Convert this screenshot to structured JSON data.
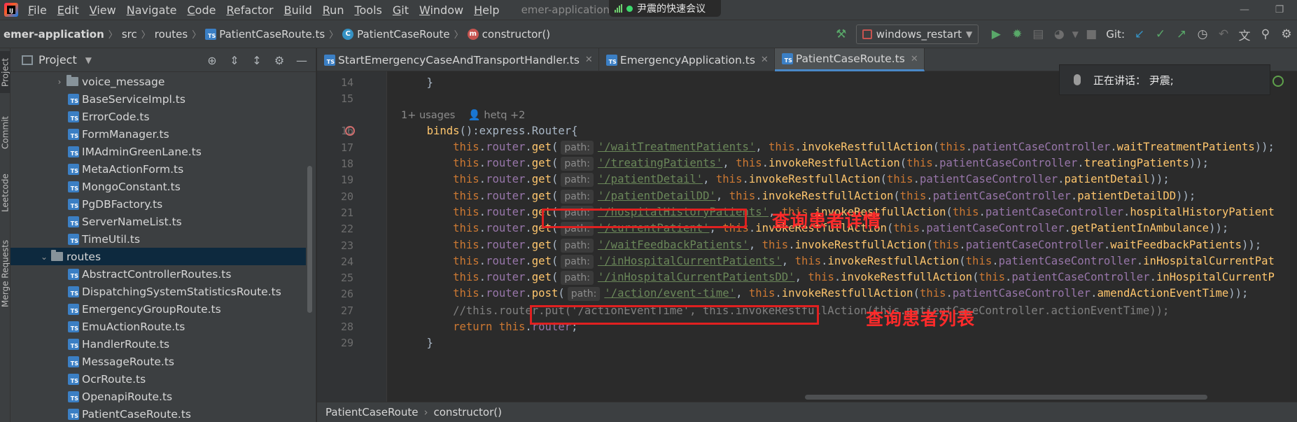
{
  "menu": {
    "items": [
      "File",
      "Edit",
      "View",
      "Navigate",
      "Code",
      "Refactor",
      "Build",
      "Run",
      "Tools",
      "Git",
      "Window",
      "Help"
    ],
    "window_title": "emer-application - P",
    "meeting_label": "尹震的快速会议"
  },
  "breadcrumb": {
    "project": "emer-application",
    "folder1": "src",
    "folder2": "routes",
    "file": "PatientCaseRoute.ts",
    "class": "PatientCaseRoute",
    "method": "constructor()"
  },
  "toolbar": {
    "run_config": "windows_restart",
    "git_label": "Git:"
  },
  "sidebar_tabs": [
    "Project",
    "Commit",
    "Leetcode",
    "Merge Requests"
  ],
  "project_panel": {
    "title": "Project",
    "tree": [
      {
        "label": "voice_message",
        "type": "folder",
        "indent": 1,
        "arrow": "›"
      },
      {
        "label": "BaseServiceImpl.ts",
        "type": "ts",
        "indent": 2
      },
      {
        "label": "ErrorCode.ts",
        "type": "ts",
        "indent": 2
      },
      {
        "label": "FormManager.ts",
        "type": "ts",
        "indent": 2
      },
      {
        "label": "IMAdminGreenLane.ts",
        "type": "ts",
        "indent": 2
      },
      {
        "label": "MetaActionForm.ts",
        "type": "ts",
        "indent": 2
      },
      {
        "label": "MongoConstant.ts",
        "type": "ts",
        "indent": 2
      },
      {
        "label": "PgDBFactory.ts",
        "type": "ts",
        "indent": 2
      },
      {
        "label": "ServerNameList.ts",
        "type": "ts",
        "indent": 2
      },
      {
        "label": "TimeUtil.ts",
        "type": "ts",
        "indent": 2
      },
      {
        "label": "routes",
        "type": "folder",
        "indent": 0,
        "arrow": "⌄",
        "selected": true
      },
      {
        "label": "AbstractControllerRoutes.ts",
        "type": "ts",
        "indent": 2
      },
      {
        "label": "DispatchingSystemStatisticsRoute.ts",
        "type": "ts",
        "indent": 2
      },
      {
        "label": "EmergencyGroupRoute.ts",
        "type": "ts",
        "indent": 2
      },
      {
        "label": "EmuActionRoute.ts",
        "type": "ts",
        "indent": 2
      },
      {
        "label": "HandlerRoute.ts",
        "type": "ts",
        "indent": 2
      },
      {
        "label": "MessageRoute.ts",
        "type": "ts",
        "indent": 2
      },
      {
        "label": "OcrRoute.ts",
        "type": "ts",
        "indent": 2
      },
      {
        "label": "OpenapiRoute.ts",
        "type": "ts",
        "indent": 2
      },
      {
        "label": "PatientCaseRoute.ts",
        "type": "ts",
        "indent": 2
      }
    ]
  },
  "tabs": [
    {
      "label": "StartEmergencyCaseAndTransportHandler.ts",
      "active": false
    },
    {
      "label": "EmergencyApplication.ts",
      "active": false
    },
    {
      "label": "PatientCaseRoute.ts",
      "active": true
    }
  ],
  "editor": {
    "usages": "1+ usages",
    "author": "hetq +2",
    "lines": [
      {
        "n": "14",
        "kind": "brace",
        "text": "    }"
      },
      {
        "n": "15",
        "kind": "blank",
        "text": ""
      },
      {
        "n": "",
        "kind": "usages",
        "text": ""
      },
      {
        "n": "16",
        "kind": "binds",
        "text": ""
      },
      {
        "n": "17",
        "kind": "route",
        "method": "get",
        "path": "/waitTreatmentPatients",
        "action": "waitTreatmentPatients",
        "tail": "));"
      },
      {
        "n": "18",
        "kind": "route",
        "method": "get",
        "path": "/treatingPatients",
        "action": "treatingPatients",
        "tail": "));"
      },
      {
        "n": "19",
        "kind": "route",
        "method": "get",
        "path": "/patientDetail",
        "action": "patientDetail",
        "tail": "));"
      },
      {
        "n": "20",
        "kind": "route",
        "method": "get",
        "path": "/patientDetailDD",
        "action": "patientDetailDD",
        "tail": "));"
      },
      {
        "n": "21",
        "kind": "route",
        "method": "get",
        "path": "/hospitalHistoryPatients",
        "action": "hospitalHistoryPatient",
        "tail": ""
      },
      {
        "n": "22",
        "kind": "route",
        "method": "get",
        "path": "/currentPatient",
        "action": "getPatientInAmbulance",
        "tail": "));"
      },
      {
        "n": "23",
        "kind": "route",
        "method": "get",
        "path": "/waitFeedbackPatients",
        "action": "waitFeedbackPatients",
        "tail": "));"
      },
      {
        "n": "24",
        "kind": "route",
        "method": "get",
        "path": "/inHospitalCurrentPatients",
        "action": "inHospitalCurrentPat",
        "tail": ""
      },
      {
        "n": "25",
        "kind": "route",
        "method": "get",
        "path": "/inHospitalCurrentPatientsDD",
        "action": "inHospitalCurrentP",
        "tail": ""
      },
      {
        "n": "26",
        "kind": "route",
        "method": "post",
        "path": "/action/event-time",
        "action": "amendActionEventTime",
        "tail": "));"
      },
      {
        "n": "27",
        "kind": "comment",
        "text": "//this.router.put('/actionEventTime', this.invokeRestfullAction(this.patientCaseController.actionEventTime));"
      },
      {
        "n": "28",
        "kind": "return",
        "text": ""
      },
      {
        "n": "29",
        "kind": "brace",
        "text": "    }"
      }
    ],
    "hint_label": "path:",
    "annotations": {
      "detail": "查询患者详情",
      "list": "查询患者列表"
    }
  },
  "speaking": {
    "text": "正在讲话：  尹震;"
  },
  "bottom_breadcrumb": {
    "class": "PatientCaseRoute",
    "method": "constructor()"
  },
  "colors": {
    "keyword": "#cc7832",
    "string": "#6a8759",
    "function": "#ffc66d",
    "field": "#9876aa",
    "annotation": "#ff2a2a"
  }
}
